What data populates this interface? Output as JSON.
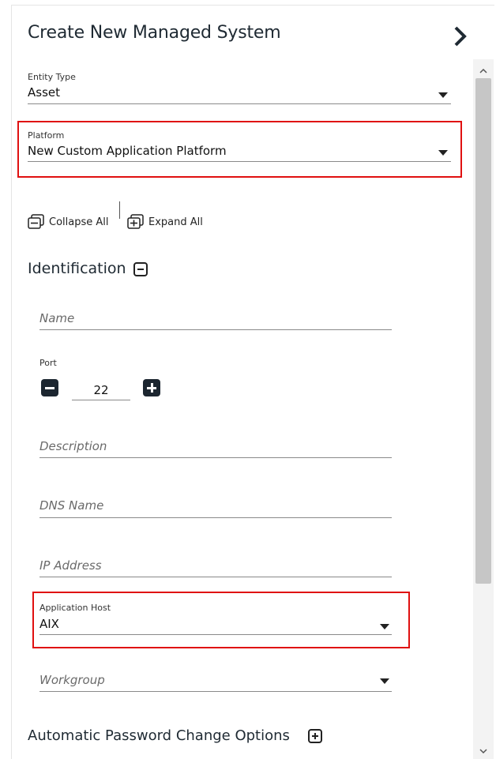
{
  "panel": {
    "title": "Create New Managed System"
  },
  "entity_type": {
    "label": "Entity Type",
    "value": "Asset"
  },
  "platform": {
    "label": "Platform",
    "value": "New Custom Application Platform"
  },
  "toolbar": {
    "collapse_all": "Collapse All",
    "expand_all": "Expand All"
  },
  "identification": {
    "title": "Identification",
    "name_placeholder": "Name",
    "port_label": "Port",
    "port_value": "22",
    "description_placeholder": "Description",
    "dns_placeholder": "DNS Name",
    "ip_placeholder": "IP Address",
    "application_host_label": "Application Host",
    "application_host_value": "AIX",
    "workgroup_placeholder": "Workgroup"
  },
  "password_options": {
    "title": "Automatic Password Change Options"
  },
  "colors": {
    "highlight": "#e01010",
    "accent_dark": "#1c2630"
  },
  "icons": {
    "close": "chevron-right-icon",
    "collapse_all": "collapse-all-icon",
    "expand_all": "expand-all-icon",
    "dropdown": "caret-down-icon",
    "scroll_up": "chevron-up-icon",
    "scroll_down": "chevron-down-icon"
  }
}
